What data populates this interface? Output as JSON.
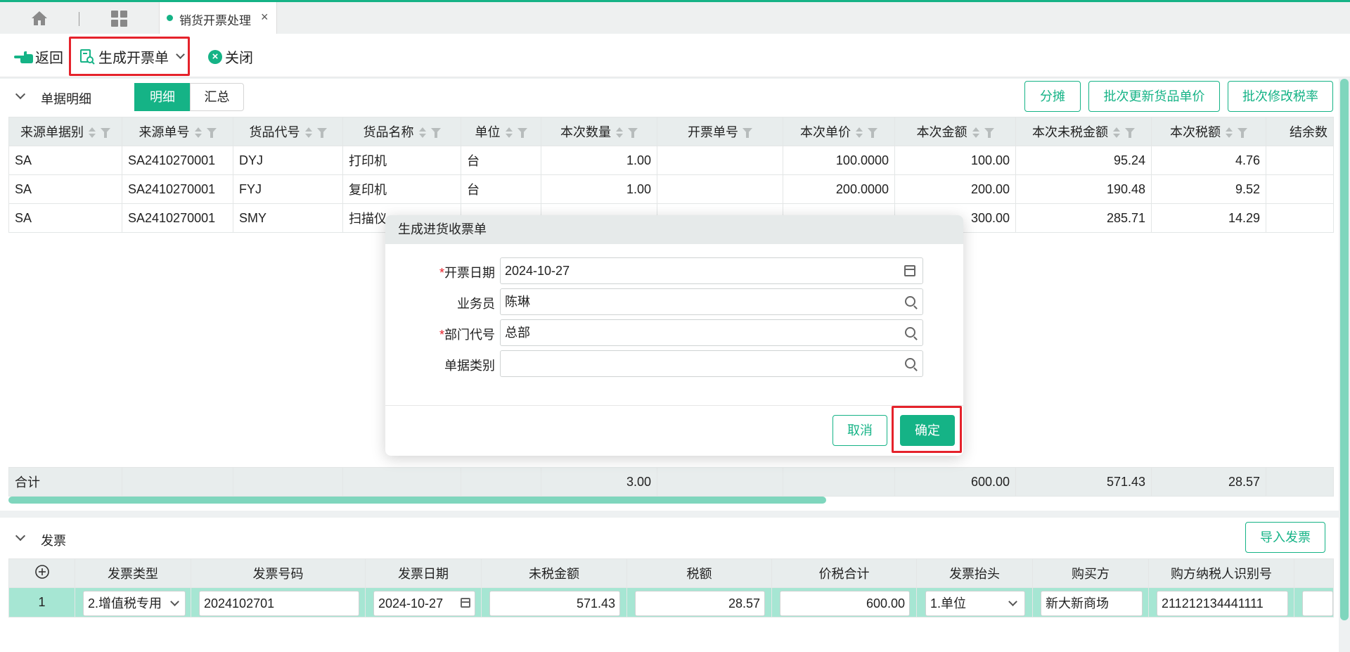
{
  "tabs": {
    "active_tab": "销货开票处理"
  },
  "toolbar": {
    "back": "返回",
    "generate": "生成开票单",
    "close": "关闭"
  },
  "detail_section": {
    "title": "单据明细",
    "seg_detail": "明细",
    "seg_summary": "汇总",
    "btn_split": "分摊",
    "btn_batch_price": "批次更新货品单价",
    "btn_batch_tax": "批次修改税率",
    "columns": [
      "来源单据别",
      "来源单号",
      "货品代号",
      "货品名称",
      "单位",
      "本次数量",
      "开票单号",
      "本次单价",
      "本次金额",
      "本次未税金额",
      "本次税额",
      "结余数"
    ],
    "rows": [
      [
        "SA",
        "SA2410270001",
        "DYJ",
        "打印机",
        "台",
        "1.00",
        "",
        "100.0000",
        "100.00",
        "95.24",
        "4.76"
      ],
      [
        "SA",
        "SA2410270001",
        "FYJ",
        "复印机",
        "台",
        "1.00",
        "",
        "200.0000",
        "200.00",
        "190.48",
        "9.52"
      ],
      [
        "SA",
        "SA2410270001",
        "SMY",
        "扫描仪",
        "",
        "",
        "",
        "",
        "300.00",
        "285.71",
        "14.29"
      ]
    ],
    "total": {
      "label": "合计",
      "qty": "3.00",
      "amount": "600.00",
      "untaxed": "571.43",
      "tax": "28.57"
    }
  },
  "invoice_section": {
    "title": "发票",
    "btn_import": "导入发票",
    "columns": [
      "发票类型",
      "发票号码",
      "发票日期",
      "未税金额",
      "税额",
      "价税合计",
      "发票抬头",
      "购买方",
      "购方纳税人识别号"
    ],
    "row": {
      "index": "1",
      "type": "2.增值税专用",
      "number": "2024102701",
      "date": "2024-10-27",
      "untaxed": "571.43",
      "tax": "28.57",
      "total": "600.00",
      "title": "1.单位",
      "buyer": "新大新商场",
      "taxid": "211212134441111"
    }
  },
  "modal": {
    "title": "生成进货收票单",
    "fields": [
      {
        "label": "开票日期",
        "value": "2024-10-27"
      },
      {
        "label": "业务员",
        "value": "陈琳"
      },
      {
        "label": "部门代号",
        "value": "总部"
      },
      {
        "label": "单据类别",
        "value": ""
      }
    ],
    "required_mark": "*",
    "cancel": "取消",
    "ok": "确定"
  },
  "colors": {
    "accent": "#15b386",
    "highlight_box": "#e5222b",
    "header_bg": "#e8eded"
  }
}
